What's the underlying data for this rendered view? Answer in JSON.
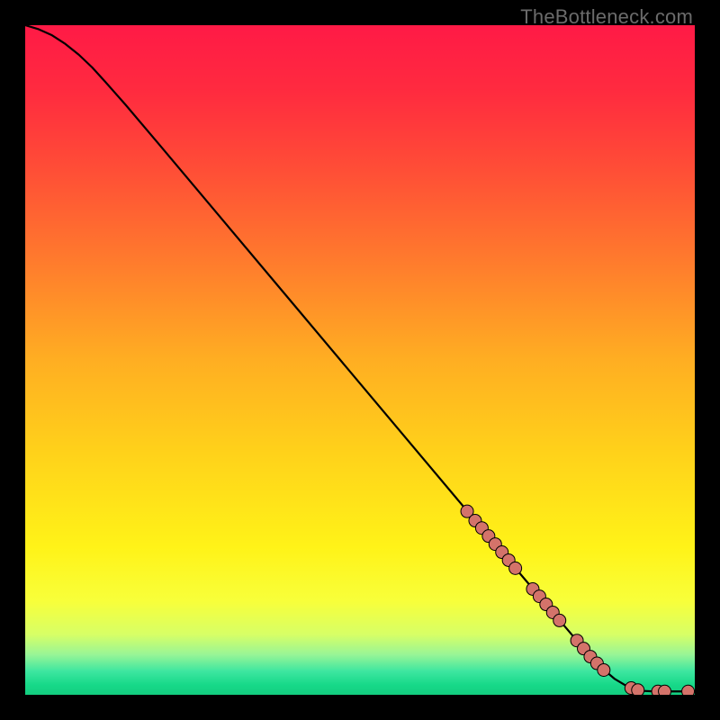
{
  "watermark": "TheBottleneck.com",
  "colors": {
    "background": "#000000",
    "gradient_stops": [
      {
        "offset": 0.0,
        "color": "#ff1a46"
      },
      {
        "offset": 0.1,
        "color": "#ff2b3f"
      },
      {
        "offset": 0.22,
        "color": "#ff4f36"
      },
      {
        "offset": 0.35,
        "color": "#ff7a2d"
      },
      {
        "offset": 0.5,
        "color": "#ffae22"
      },
      {
        "offset": 0.64,
        "color": "#ffd21a"
      },
      {
        "offset": 0.78,
        "color": "#fff318"
      },
      {
        "offset": 0.86,
        "color": "#f8ff3a"
      },
      {
        "offset": 0.91,
        "color": "#d7ff66"
      },
      {
        "offset": 0.94,
        "color": "#98f596"
      },
      {
        "offset": 0.965,
        "color": "#3de6a0"
      },
      {
        "offset": 0.985,
        "color": "#17d989"
      },
      {
        "offset": 1.0,
        "color": "#13ce7f"
      }
    ],
    "curve": "#000000",
    "marker_fill": "#d4736a",
    "marker_stroke": "#000000",
    "watermark": "#6b6b6b"
  },
  "chart_data": {
    "type": "line",
    "title": "",
    "xlabel": "",
    "ylabel": "",
    "xlim": [
      0,
      100
    ],
    "ylim": [
      0,
      100
    ],
    "grid": false,
    "legend": false,
    "series": [
      {
        "name": "curve",
        "x": [
          0,
          2,
          4,
          6,
          8,
          10,
          12,
          15,
          20,
          30,
          40,
          50,
          60,
          70,
          75,
          80,
          84,
          86,
          88,
          90,
          92,
          94,
          96,
          98,
          100
        ],
        "y": [
          100,
          99.4,
          98.5,
          97.2,
          95.6,
          93.7,
          91.5,
          88.1,
          82.2,
          70.3,
          58.4,
          46.5,
          34.6,
          22.7,
          16.8,
          10.9,
          6.2,
          4.1,
          2.4,
          1.2,
          0.6,
          0.5,
          0.5,
          0.5,
          0.5
        ]
      }
    ],
    "markers": [
      {
        "x": 66.0,
        "y": 27.4
      },
      {
        "x": 67.2,
        "y": 26.0
      },
      {
        "x": 68.2,
        "y": 24.9
      },
      {
        "x": 69.2,
        "y": 23.7
      },
      {
        "x": 70.2,
        "y": 22.5
      },
      {
        "x": 71.2,
        "y": 21.3
      },
      {
        "x": 72.2,
        "y": 20.1
      },
      {
        "x": 73.2,
        "y": 18.9
      },
      {
        "x": 75.8,
        "y": 15.8
      },
      {
        "x": 76.8,
        "y": 14.7
      },
      {
        "x": 77.8,
        "y": 13.5
      },
      {
        "x": 78.8,
        "y": 12.3
      },
      {
        "x": 79.8,
        "y": 11.1
      },
      {
        "x": 82.4,
        "y": 8.1
      },
      {
        "x": 83.4,
        "y": 6.9
      },
      {
        "x": 84.4,
        "y": 5.7
      },
      {
        "x": 85.4,
        "y": 4.7
      },
      {
        "x": 86.4,
        "y": 3.7
      },
      {
        "x": 90.5,
        "y": 1.0
      },
      {
        "x": 91.5,
        "y": 0.7
      },
      {
        "x": 94.5,
        "y": 0.5
      },
      {
        "x": 95.5,
        "y": 0.5
      },
      {
        "x": 99.0,
        "y": 0.5
      }
    ],
    "marker_radius_px": 7
  }
}
